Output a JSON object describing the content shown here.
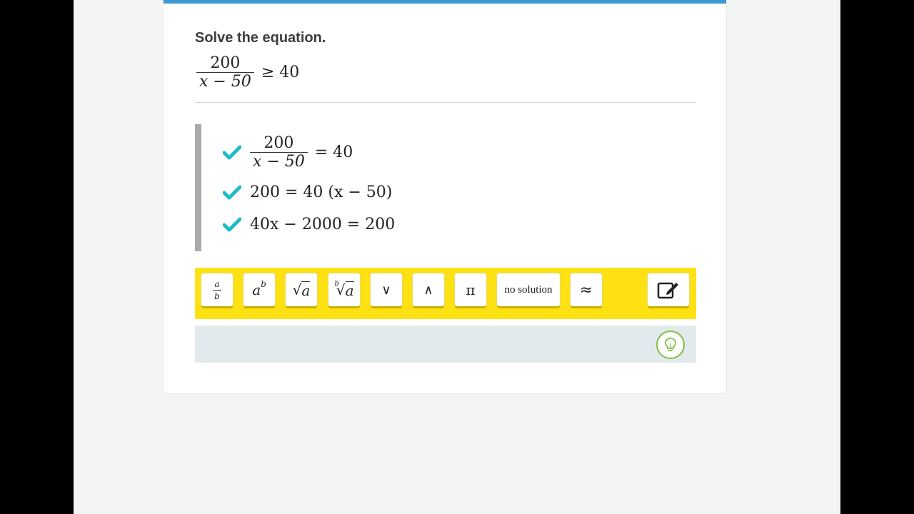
{
  "prompt": "Solve the equation.",
  "problem": {
    "numerator": "200",
    "denominator": "x − 50",
    "relation": "≥ 40"
  },
  "steps": [
    {
      "numerator": "200",
      "denominator": "x − 50",
      "rest": "= 40"
    },
    {
      "text": "200 = 40 (x − 50)"
    },
    {
      "text": "40x − 2000 = 200"
    }
  ],
  "keypad": {
    "fraction": {
      "top": "a",
      "bottom": "b"
    },
    "exponent": {
      "base": "a",
      "power": "b"
    },
    "sqrt": {
      "symbol": "√",
      "arg": "a"
    },
    "nthroot": {
      "index": "b",
      "symbol": "√",
      "arg": "a"
    },
    "or": "∨",
    "and": "∧",
    "pi": "π",
    "no_solution": "no solution",
    "approx": "≈"
  },
  "colors": {
    "accent_blue": "#3d97d3",
    "check_teal": "#1fbcc4",
    "toolbar_yellow": "#fee113",
    "hint_green": "#7cc043"
  }
}
